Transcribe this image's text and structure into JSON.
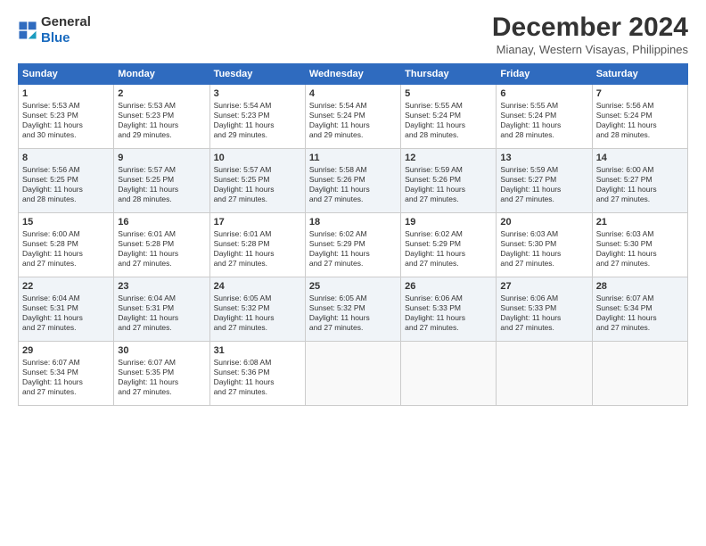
{
  "header": {
    "logo_general": "General",
    "logo_blue": "Blue",
    "month_year": "December 2024",
    "location": "Mianay, Western Visayas, Philippines"
  },
  "days_of_week": [
    "Sunday",
    "Monday",
    "Tuesday",
    "Wednesday",
    "Thursday",
    "Friday",
    "Saturday"
  ],
  "weeks": [
    {
      "cells": [
        {
          "day": "1",
          "lines": [
            "Sunrise: 5:53 AM",
            "Sunset: 5:23 PM",
            "Daylight: 11 hours",
            "and 30 minutes."
          ]
        },
        {
          "day": "2",
          "lines": [
            "Sunrise: 5:53 AM",
            "Sunset: 5:23 PM",
            "Daylight: 11 hours",
            "and 29 minutes."
          ]
        },
        {
          "day": "3",
          "lines": [
            "Sunrise: 5:54 AM",
            "Sunset: 5:23 PM",
            "Daylight: 11 hours",
            "and 29 minutes."
          ]
        },
        {
          "day": "4",
          "lines": [
            "Sunrise: 5:54 AM",
            "Sunset: 5:24 PM",
            "Daylight: 11 hours",
            "and 29 minutes."
          ]
        },
        {
          "day": "5",
          "lines": [
            "Sunrise: 5:55 AM",
            "Sunset: 5:24 PM",
            "Daylight: 11 hours",
            "and 28 minutes."
          ]
        },
        {
          "day": "6",
          "lines": [
            "Sunrise: 5:55 AM",
            "Sunset: 5:24 PM",
            "Daylight: 11 hours",
            "and 28 minutes."
          ]
        },
        {
          "day": "7",
          "lines": [
            "Sunrise: 5:56 AM",
            "Sunset: 5:24 PM",
            "Daylight: 11 hours",
            "and 28 minutes."
          ]
        }
      ]
    },
    {
      "cells": [
        {
          "day": "8",
          "lines": [
            "Sunrise: 5:56 AM",
            "Sunset: 5:25 PM",
            "Daylight: 11 hours",
            "and 28 minutes."
          ]
        },
        {
          "day": "9",
          "lines": [
            "Sunrise: 5:57 AM",
            "Sunset: 5:25 PM",
            "Daylight: 11 hours",
            "and 28 minutes."
          ]
        },
        {
          "day": "10",
          "lines": [
            "Sunrise: 5:57 AM",
            "Sunset: 5:25 PM",
            "Daylight: 11 hours",
            "and 27 minutes."
          ]
        },
        {
          "day": "11",
          "lines": [
            "Sunrise: 5:58 AM",
            "Sunset: 5:26 PM",
            "Daylight: 11 hours",
            "and 27 minutes."
          ]
        },
        {
          "day": "12",
          "lines": [
            "Sunrise: 5:59 AM",
            "Sunset: 5:26 PM",
            "Daylight: 11 hours",
            "and 27 minutes."
          ]
        },
        {
          "day": "13",
          "lines": [
            "Sunrise: 5:59 AM",
            "Sunset: 5:27 PM",
            "Daylight: 11 hours",
            "and 27 minutes."
          ]
        },
        {
          "day": "14",
          "lines": [
            "Sunrise: 6:00 AM",
            "Sunset: 5:27 PM",
            "Daylight: 11 hours",
            "and 27 minutes."
          ]
        }
      ]
    },
    {
      "cells": [
        {
          "day": "15",
          "lines": [
            "Sunrise: 6:00 AM",
            "Sunset: 5:28 PM",
            "Daylight: 11 hours",
            "and 27 minutes."
          ]
        },
        {
          "day": "16",
          "lines": [
            "Sunrise: 6:01 AM",
            "Sunset: 5:28 PM",
            "Daylight: 11 hours",
            "and 27 minutes."
          ]
        },
        {
          "day": "17",
          "lines": [
            "Sunrise: 6:01 AM",
            "Sunset: 5:28 PM",
            "Daylight: 11 hours",
            "and 27 minutes."
          ]
        },
        {
          "day": "18",
          "lines": [
            "Sunrise: 6:02 AM",
            "Sunset: 5:29 PM",
            "Daylight: 11 hours",
            "and 27 minutes."
          ]
        },
        {
          "day": "19",
          "lines": [
            "Sunrise: 6:02 AM",
            "Sunset: 5:29 PM",
            "Daylight: 11 hours",
            "and 27 minutes."
          ]
        },
        {
          "day": "20",
          "lines": [
            "Sunrise: 6:03 AM",
            "Sunset: 5:30 PM",
            "Daylight: 11 hours",
            "and 27 minutes."
          ]
        },
        {
          "day": "21",
          "lines": [
            "Sunrise: 6:03 AM",
            "Sunset: 5:30 PM",
            "Daylight: 11 hours",
            "and 27 minutes."
          ]
        }
      ]
    },
    {
      "cells": [
        {
          "day": "22",
          "lines": [
            "Sunrise: 6:04 AM",
            "Sunset: 5:31 PM",
            "Daylight: 11 hours",
            "and 27 minutes."
          ]
        },
        {
          "day": "23",
          "lines": [
            "Sunrise: 6:04 AM",
            "Sunset: 5:31 PM",
            "Daylight: 11 hours",
            "and 27 minutes."
          ]
        },
        {
          "day": "24",
          "lines": [
            "Sunrise: 6:05 AM",
            "Sunset: 5:32 PM",
            "Daylight: 11 hours",
            "and 27 minutes."
          ]
        },
        {
          "day": "25",
          "lines": [
            "Sunrise: 6:05 AM",
            "Sunset: 5:32 PM",
            "Daylight: 11 hours",
            "and 27 minutes."
          ]
        },
        {
          "day": "26",
          "lines": [
            "Sunrise: 6:06 AM",
            "Sunset: 5:33 PM",
            "Daylight: 11 hours",
            "and 27 minutes."
          ]
        },
        {
          "day": "27",
          "lines": [
            "Sunrise: 6:06 AM",
            "Sunset: 5:33 PM",
            "Daylight: 11 hours",
            "and 27 minutes."
          ]
        },
        {
          "day": "28",
          "lines": [
            "Sunrise: 6:07 AM",
            "Sunset: 5:34 PM",
            "Daylight: 11 hours",
            "and 27 minutes."
          ]
        }
      ]
    },
    {
      "cells": [
        {
          "day": "29",
          "lines": [
            "Sunrise: 6:07 AM",
            "Sunset: 5:34 PM",
            "Daylight: 11 hours",
            "and 27 minutes."
          ]
        },
        {
          "day": "30",
          "lines": [
            "Sunrise: 6:07 AM",
            "Sunset: 5:35 PM",
            "Daylight: 11 hours",
            "and 27 minutes."
          ]
        },
        {
          "day": "31",
          "lines": [
            "Sunrise: 6:08 AM",
            "Sunset: 5:36 PM",
            "Daylight: 11 hours",
            "and 27 minutes."
          ]
        },
        {
          "day": "",
          "lines": []
        },
        {
          "day": "",
          "lines": []
        },
        {
          "day": "",
          "lines": []
        },
        {
          "day": "",
          "lines": []
        }
      ]
    }
  ]
}
